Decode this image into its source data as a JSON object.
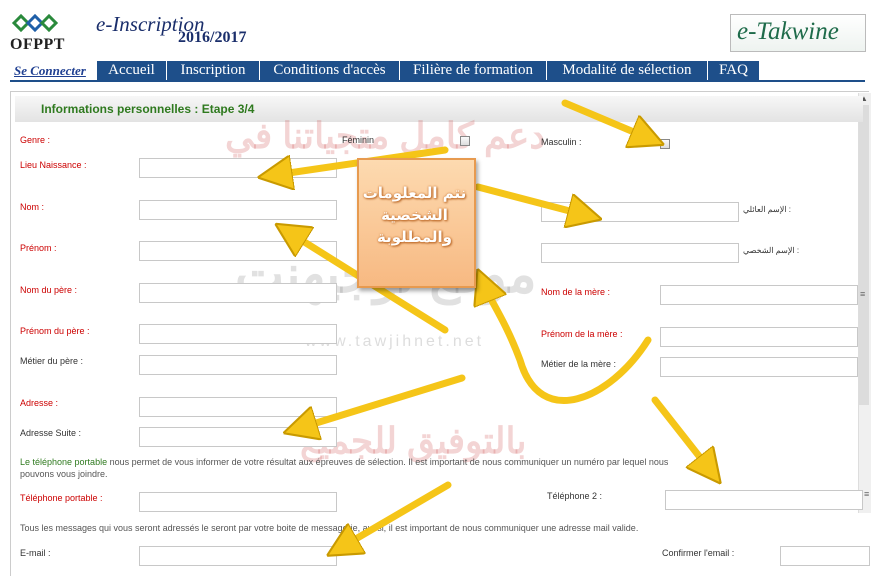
{
  "header": {
    "logo_text": "OFPPT",
    "app_title": "e-Inscription",
    "year": "2016/2017",
    "brand": "e-Takwine"
  },
  "nav": {
    "connect": "Se Connecter",
    "items": [
      "Accueil",
      "Inscription",
      "Conditions d'accès",
      "Filière de formation",
      "Modalité de sélection",
      "FAQ"
    ]
  },
  "form": {
    "section_title": "Informations personnelles : Etape 3/4",
    "genre": "Genre :",
    "feminin": "Féminin",
    "masculin": "Masculin :",
    "lieu": "Lieu Naissance :",
    "nom": "Nom :",
    "nom_ar": "الإسم العائلي :",
    "prenom": "Prénom :",
    "prenom_ar": "الإسم الشخصي :",
    "nom_pere": "Nom du père :",
    "nom_mere": "Nom de la mère :",
    "prenom_pere": "Prénom du père :",
    "prenom_mere": "Prénom de la mère :",
    "metier_pere": "Métier du père :",
    "metier_mere": "Métier de la mère :",
    "adresse": "Adresse :",
    "adresse_suite": "Adresse Suite :",
    "tel_note_green": "Le téléphone portable",
    "tel_note_rest": " nous permet de vous informer de votre résultat aux épreuves de sélection. Il est important de nous communiquer un numéro par lequel nous",
    "tel_note_line2": "pouvons vous joindre.",
    "tel_portable": "Téléphone portable :",
    "tel2": "Téléphone 2 :",
    "mail_note": "Tous les messages qui vous seront adressés le seront par votre boite de messagerie, aussi, il est important de nous communiquer une adresse mail valide.",
    "email": "E-mail :",
    "confirm_email": "Confirmer l'email :"
  },
  "callout": {
    "line1": "نتم المعلومات",
    "line2": "الشخصية",
    "line3": "والمطلوبة"
  },
  "watermark": {
    "line1": "دعم كامل متجياتنا في",
    "line2": "موقع توجيهنت",
    "url": "www.tawjihnet.net",
    "line4": "بالتوفيق للجميع"
  },
  "colors": {
    "nav_bg": "#1e4f8a",
    "title_green": "#2f7a1f",
    "required_red": "#cc0000",
    "arrow": "#f5c518"
  }
}
